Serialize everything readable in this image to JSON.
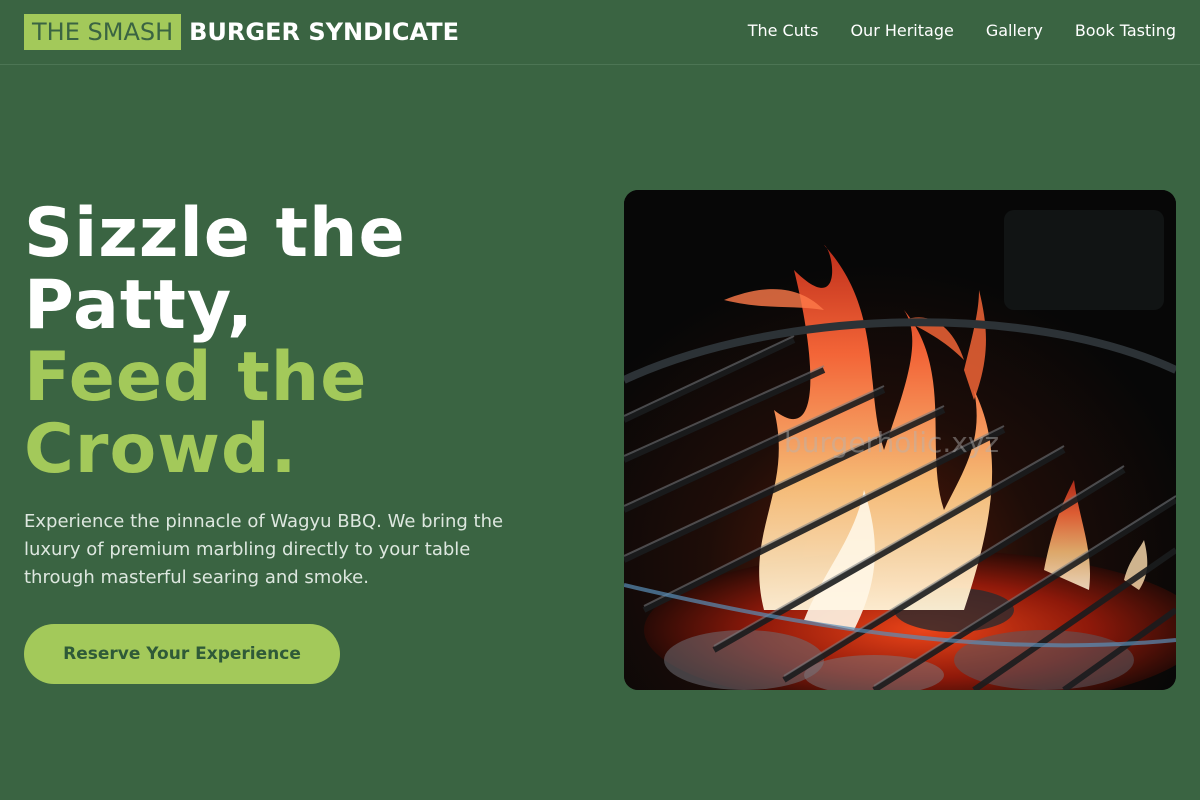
{
  "brand": {
    "highlight": "THE SMASH",
    "rest": "BURGER SYNDICATE",
    "accent_color": "#a3c95a",
    "background_color": "#3a6442"
  },
  "nav": {
    "items": [
      {
        "label": "The Cuts"
      },
      {
        "label": "Our Heritage"
      },
      {
        "label": "Gallery"
      },
      {
        "label": "Book Tasting"
      }
    ]
  },
  "hero": {
    "title_line1": "Sizzle the",
    "title_line2": "Patty,",
    "title_line3": "Feed the",
    "title_line4": "Crowd.",
    "description": "Experience the pinnacle of Wagyu BBQ. We bring the luxury of premium marbling directly to your table through masterful searing and smoke.",
    "cta_label": "Reserve Your Experience"
  },
  "image": {
    "alt": "flames-over-charcoal-grill",
    "watermark": "burgerholic.xyz"
  }
}
